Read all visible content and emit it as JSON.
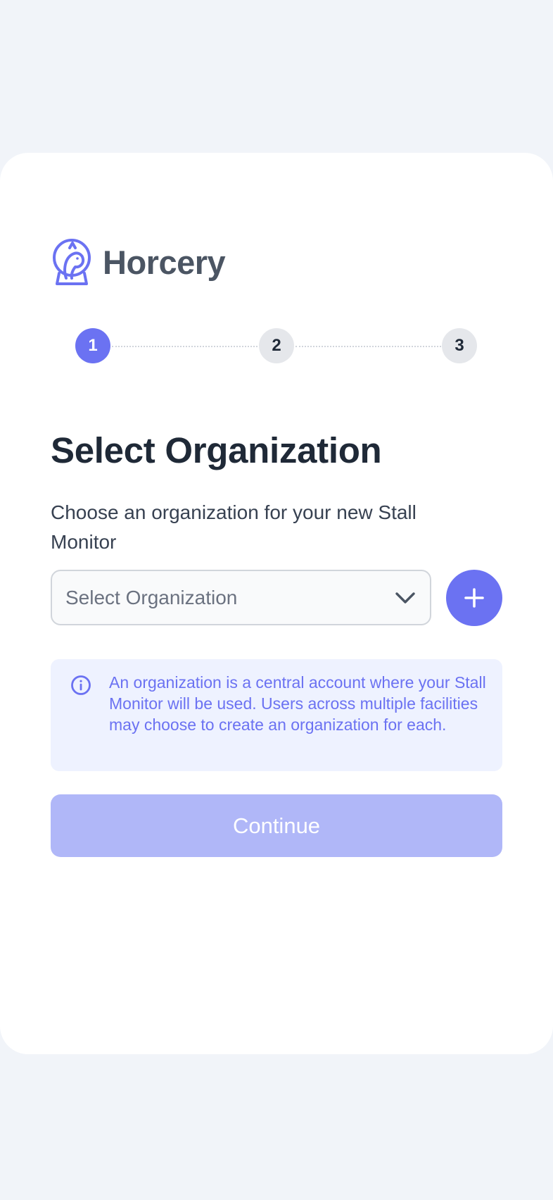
{
  "brand": {
    "name": "Horcery",
    "icon": "horse-head-logo-icon"
  },
  "stepper": {
    "steps": [
      {
        "label": "1",
        "state": "active"
      },
      {
        "label": "2",
        "state": "inactive"
      },
      {
        "label": "3",
        "state": "inactive"
      }
    ]
  },
  "page": {
    "title": "Select Organization",
    "subtitle": "Choose an organization for your new Stall Monitor"
  },
  "organization_select": {
    "value": "Select Organization",
    "icon": "chevron-down-icon"
  },
  "add_button": {
    "icon": "plus-icon"
  },
  "info": {
    "icon": "info-circle-icon",
    "text": "An organization is a central account where your Stall Monitor will be used. Users across multiple facilities may choose to create an organization for each."
  },
  "continue_button": {
    "label": "Continue"
  },
  "colors": {
    "background": "#f1f4f9",
    "accent": "#6b72f2",
    "accent_disabled": "#b0b7f8",
    "info_background": "#eef2ff"
  }
}
